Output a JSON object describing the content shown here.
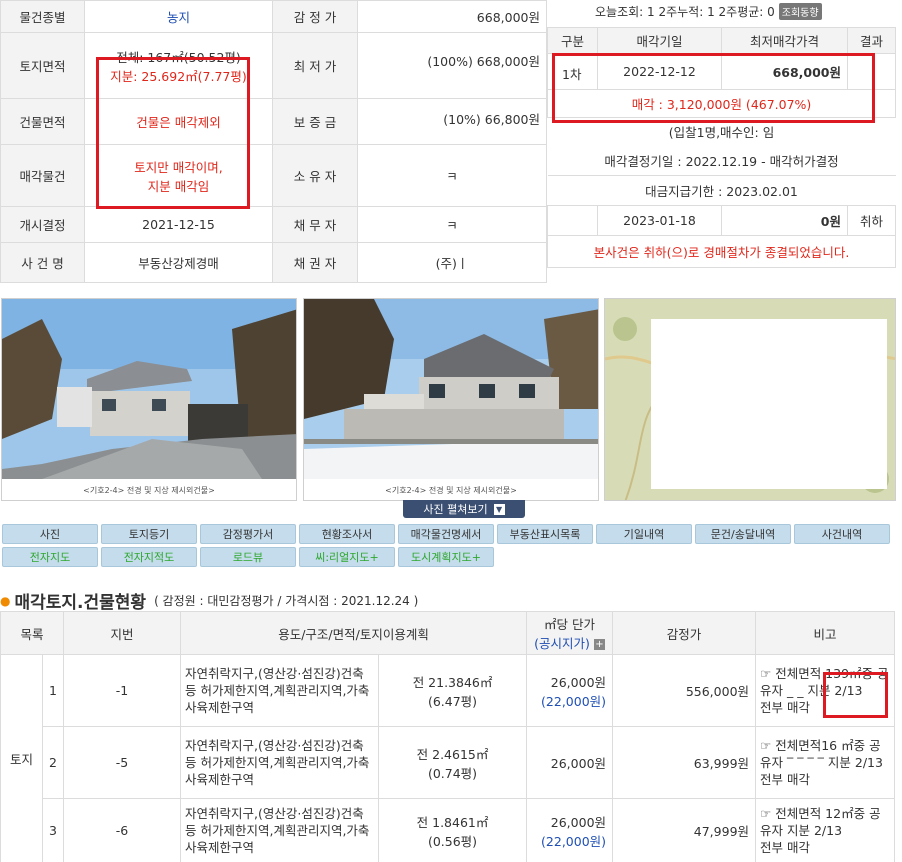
{
  "info": {
    "rows": [
      {
        "h1": "물건종별",
        "v1": "농지",
        "h2": "감 정 가",
        "v2": "668,000원"
      },
      {
        "h1": "토지면적",
        "v1a": "전체: 167㎡(50.52평)",
        "v1b": "지분: 25.692㎡(7.77평)",
        "h2": "최 저 가",
        "v2": "(100%) 668,000원"
      },
      {
        "h1": "건물면적",
        "v1": "건물은 매각제외",
        "h2": "보 증 금",
        "v2": "(10%) 66,800원"
      },
      {
        "h1": "매각물건",
        "v1a": "토지만 매각이며,",
        "v1b": "지분 매각임",
        "h2": "소 유 자",
        "v2": "ㅋ"
      },
      {
        "h1": "개시결정",
        "v1": "2021-12-15",
        "h2": "채 무 자",
        "v2": "ㅋ"
      },
      {
        "h1": "사 건 명",
        "v1": "부동산강제경매",
        "h2": "채 권 자",
        "v2": "(주)ㅣ"
      }
    ]
  },
  "sale": {
    "stats_label": "오늘조회: 1  2주누적: 1  2주평균: 0",
    "stats_badge": "조회동향",
    "headers": [
      "구분",
      "매각기일",
      "최저매각가격",
      "결과"
    ],
    "round": "1차",
    "date": "2022-12-12",
    "price": "668,000원",
    "result": "",
    "sold": "매각 : 3,120,000원  (467.07%)",
    "bidders": "(입찰1명,매수인:                임",
    "decision": "매각결정기일 : 2022.12.19 - 매각허가결정",
    "payment": "대금지급기한 : 2023.02.01",
    "date2": "2023-01-18",
    "price2": "0원",
    "result2": "취하",
    "notice": "본사건은 취하(으)로 경매절차가 종결되었습니다."
  },
  "photos": {
    "caption1": "<기호2-4> 전경 및 지상 제시외건물>",
    "caption2": "<기호2-4> 전경 및 지상 제시외건물>",
    "flat_view": "사진 펼쳐보기"
  },
  "tabs": [
    {
      "label": "사진",
      "green": false
    },
    {
      "label": "토지등기",
      "green": false
    },
    {
      "label": "감정평가서",
      "green": false
    },
    {
      "label": "현황조사서",
      "green": false
    },
    {
      "label": "매각물건명세서",
      "green": false
    },
    {
      "label": "부동산표시목록",
      "green": false
    },
    {
      "label": "기일내역",
      "green": false
    },
    {
      "label": "문건/송달내역",
      "green": false
    },
    {
      "label": "사건내역",
      "green": false
    },
    {
      "label": "전자지도",
      "green": true
    },
    {
      "label": "전자지적도",
      "green": true
    },
    {
      "label": "로드뷰",
      "green": true
    },
    {
      "label": "씨:리얼지도+",
      "green": true
    },
    {
      "label": "도시계획지도+",
      "green": true
    }
  ],
  "section": {
    "title": "매각토지.건물현황",
    "subtitle": "( 감정원 : 대민감정평가 / 가격시점 : 2021.12.24 )"
  },
  "land": {
    "headers": {
      "list": "목록",
      "lot": "지번",
      "use": "용도/구조/면적/토지이용계획",
      "unit": "㎡당 단가",
      "unit_sub": "(공시지가)",
      "appraisal": "감정가",
      "note": "비고"
    },
    "group_label": "토지",
    "rows": [
      {
        "no": "1",
        "lot": "-1",
        "use": "자연취락지구,(영산강·섬진강)건축등 허가제한지역,계획관리지역,가축사육제한구역",
        "area": "전 21.3846㎡",
        "pyeong": "(6.47평)",
        "unit": "26,000원",
        "official": "(22,000원)",
        "appraisal": "556,000원",
        "note1": "☞ 전체면적 139㎡중 공",
        "note2": "유자    _ _ 지분 2/13",
        "note3": "전부 매각"
      },
      {
        "no": "2",
        "lot": "-5",
        "use": "자연취락지구,(영산강·섬진강)건축등 허가제한지역,계획관리지역,가축사육제한구역",
        "area": "전 2.4615㎡",
        "pyeong": "(0.74평)",
        "unit": "26,000원",
        "official": "",
        "appraisal": "63,999원",
        "note1": "☞ 전체면적16 ㎡중 공",
        "note2": "유자 ‾ ‾ ‾ ‾  지분 2/13",
        "note3": "전부 매각"
      },
      {
        "no": "3",
        "lot": "-6",
        "use": "자연취락지구,(영산강·섬진강)건축등 허가제한지역,계획관리지역,가축사육제한구역",
        "area": "전 1.8461㎡",
        "pyeong": "(0.56평)",
        "unit": "26,000원",
        "official": "(22,000원)",
        "appraisal": "47,999원",
        "note1": "☞ 전체면적 12㎡중 공",
        "note2": "유자          지분 2/13",
        "note3": "전부 매각"
      }
    ]
  }
}
